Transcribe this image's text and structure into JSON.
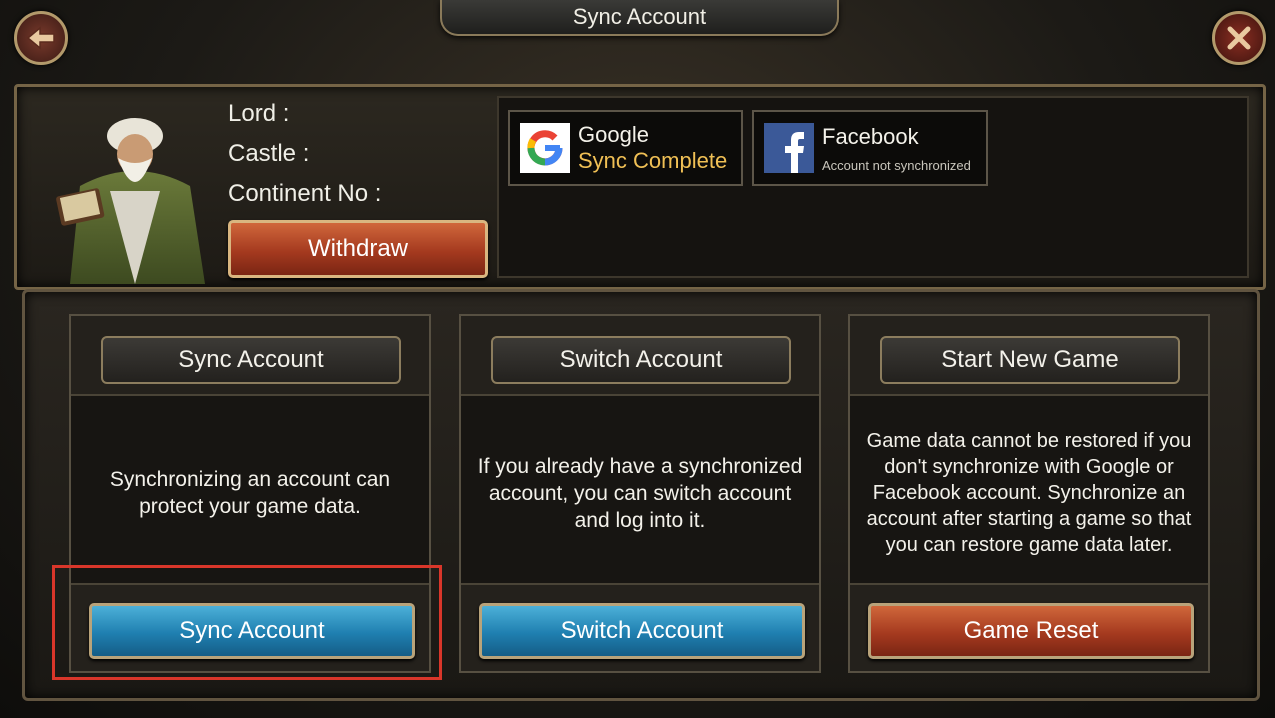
{
  "header": {
    "title": "Sync Account"
  },
  "icons": {
    "back": "back-arrow-icon",
    "close": "close-x-icon"
  },
  "profile": {
    "lord_label": "Lord :",
    "castle_label": "Castle :",
    "continent_label": "Continent No :",
    "withdraw_label": "Withdraw"
  },
  "accounts": {
    "google": {
      "name": "Google",
      "status": "Sync Complete"
    },
    "facebook": {
      "name": "Facebook",
      "status": "Account not synchronized"
    }
  },
  "columns": {
    "sync": {
      "title": "Sync Account",
      "description": "Synchronizing an account can protect your game data.",
      "button": "Sync Account"
    },
    "switch": {
      "title": "Switch Account",
      "description": "If you already have a synchronized account, you can switch account and log into it.",
      "button": "Switch Account"
    },
    "new_game": {
      "title": "Start New Game",
      "description": "Game data cannot be restored if you don't synchronize with Google or Facebook account. Synchronize an account after starting a game so that you can restore game data later.",
      "button": "Game Reset"
    }
  },
  "colors": {
    "accent_gold": "#f0c055",
    "blue_button": "#1f7fb0",
    "red_button": "#a53a1f",
    "highlight_box": "#d9362a"
  }
}
